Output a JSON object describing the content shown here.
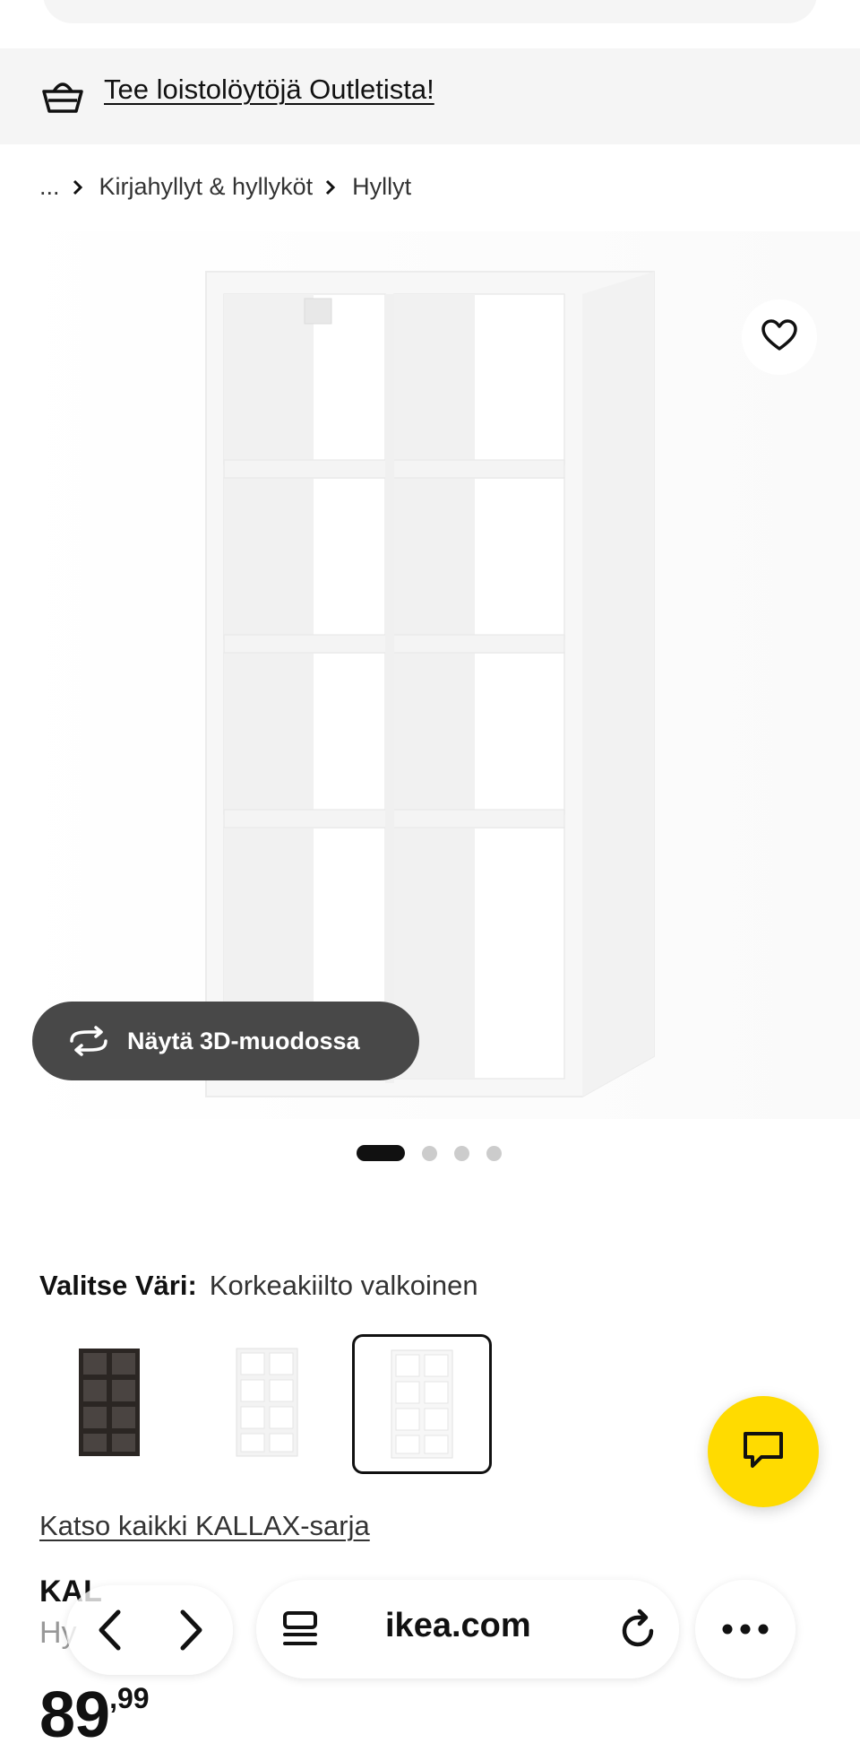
{
  "banner": {
    "link_text": "Tee loistolöytöjä Outletista!",
    "icon": "shopping-basket-icon"
  },
  "breadcrumb": {
    "items": [
      "...",
      "Kirjahyllyt & hyllyköt",
      "Hyllyt"
    ]
  },
  "product_image": {
    "favorite_icon": "heart-icon"
  },
  "view_3d": {
    "label": "Näytä 3D-muodossa",
    "icon": "rotate-3d-icon"
  },
  "carousel": {
    "total": 4,
    "active": 1
  },
  "color": {
    "label": "Valitse Väri:",
    "value": "Korkeakiilto valkoinen",
    "options": [
      {
        "name": "black-brown",
        "color": "#2b2623"
      },
      {
        "name": "white",
        "color": "#f3f3f3"
      },
      {
        "name": "high-gloss-white",
        "color": "#f7f7f7",
        "selected": true
      }
    ]
  },
  "series_link": "Katso kaikki KALLAX-sarja",
  "chat": {
    "icon": "chat-icon",
    "color": "#ffdb00"
  },
  "product": {
    "name_partial": "KAL",
    "desc_partial": "Hy",
    "price_int": "89",
    "price_dec": ",99"
  },
  "browser": {
    "url": "ikea.com",
    "back_icon": "chevron-left-icon",
    "forward_icon": "chevron-right-icon",
    "reader_icon": "reader-icon",
    "reload_icon": "reload-icon",
    "more_icon": "more-icon"
  }
}
